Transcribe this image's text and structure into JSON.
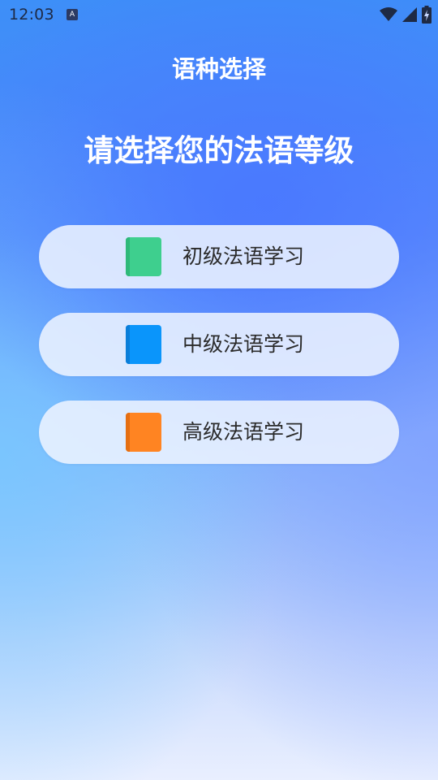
{
  "status_bar": {
    "time": "12:03",
    "app_icon_glyph": "A",
    "icons": [
      "wifi-icon",
      "cell-signal-icon",
      "battery-charging-icon"
    ]
  },
  "header": {
    "title": "语种选择",
    "subtitle": "请选择您的法语等级"
  },
  "levels": [
    {
      "label": "初级法语学习",
      "icon": "book-icon",
      "color": "#3ecf8e",
      "spine_color": "#2fb97a"
    },
    {
      "label": "中级法语学习",
      "icon": "book-icon",
      "color": "#0a95fb",
      "spine_color": "#0a7ed9"
    },
    {
      "label": "高级法语学习",
      "icon": "book-icon",
      "color": "#ff8422",
      "spine_color": "#e56f12"
    }
  ],
  "colors": {
    "button_bg": "#ecf2ff",
    "label_text": "#2b2b2b",
    "header_text": "#ffffff"
  }
}
